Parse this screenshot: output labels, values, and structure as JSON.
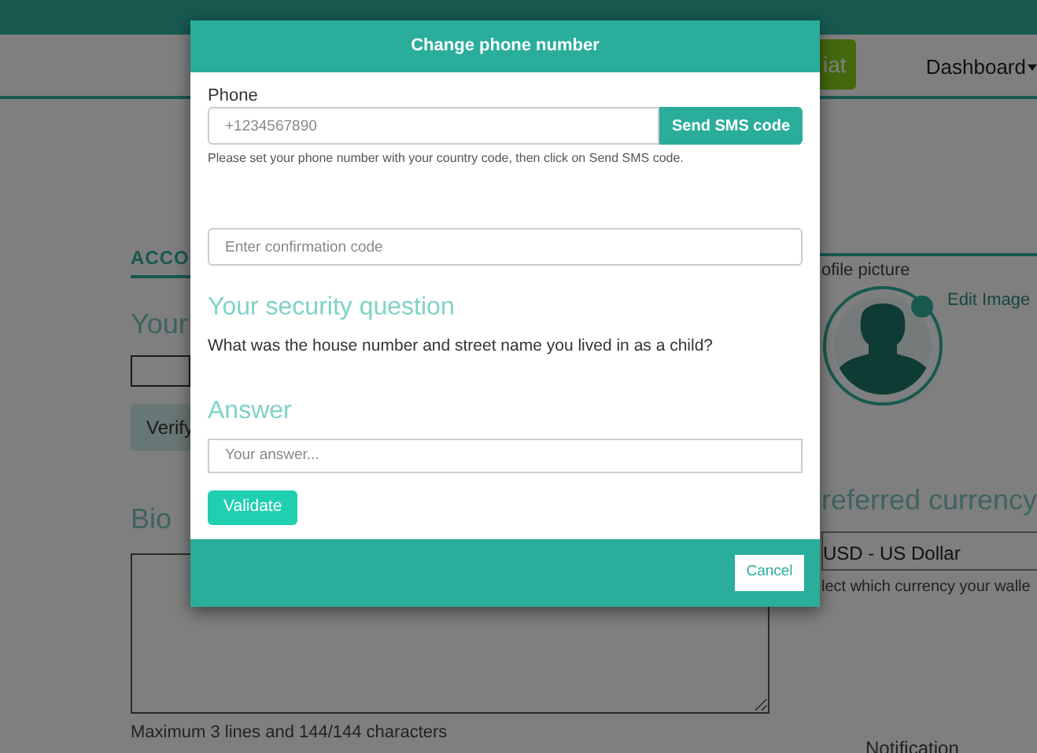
{
  "top_nav": {
    "button_label": "iat",
    "menu_label": "Dashboard"
  },
  "account": {
    "heading": "ACCO",
    "subheading": "Your",
    "verify_button": "Verify",
    "bio_label": "Bio",
    "bio_hint": "Maximum 3 lines and 144/144 characters"
  },
  "profile": {
    "label": "ofile picture",
    "edit_link": "Edit Image"
  },
  "currency": {
    "label": "referred currency",
    "value": "USD - US Dollar",
    "hint": "lect which currency your walle"
  },
  "notification_label": "Notification",
  "dialog": {
    "title": "Change phone number",
    "phone_label": "Phone",
    "phone_placeholder": "+1234567890",
    "send_button": "Send SMS code",
    "phone_help": "Please set your phone number with your country code, then click on Send SMS code.",
    "code_placeholder": "Enter confirmation code",
    "question_heading": "Your security question",
    "question": "What was the house number and street name you lived in as a child?",
    "answer_heading": "Answer",
    "answer_placeholder": "Your answer...",
    "validate_button": "Validate",
    "cancel_button": "Cancel"
  }
}
